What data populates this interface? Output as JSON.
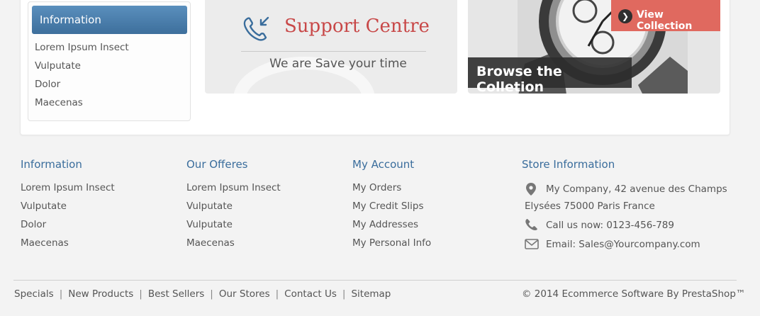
{
  "info_box": {
    "title": "Information",
    "items": [
      "Lorem Ipsum Insect",
      "Vulputate",
      "Dolor",
      "Maecenas"
    ]
  },
  "support": {
    "title": "Support Centre",
    "subtitle": "We are Save your time",
    "icon": "phone-callback-icon"
  },
  "collection": {
    "button_label": "View Collection",
    "browse_label": "Browse the Colletion",
    "icon": "chevron-right-icon"
  },
  "footer": {
    "information": {
      "title": "Information",
      "items": [
        "Lorem Ipsum Insect",
        "Vulputate",
        "Dolor",
        "Maecenas"
      ]
    },
    "offers": {
      "title": "Our Offeres",
      "items": [
        "Lorem Ipsum Insect",
        "Vulputate",
        "Vulputate",
        "Maecenas"
      ]
    },
    "account": {
      "title": "My Account",
      "items": [
        "My Orders",
        "My Credit Slips",
        "My Addresses",
        "My Personal Info"
      ]
    },
    "store": {
      "title": "Store Information",
      "address_line1": "My Company, 42 avenue des Champs",
      "address_line2": "Elysées 75000 Paris France",
      "phone": "Call us now: 0123-456-789",
      "email": "Email: Sales@Yourcompany.com"
    }
  },
  "bottom_bar": {
    "links": [
      "Specials",
      "New Products",
      "Best Sellers",
      "Our Stores",
      "Contact Us",
      "Sitemap"
    ],
    "copyright": "© 2014 Ecommerce Software By PrestaShop™"
  },
  "colors": {
    "accent_blue": "#3a6d9c",
    "accent_red": "#c84848",
    "button_red": "#e0695f"
  }
}
